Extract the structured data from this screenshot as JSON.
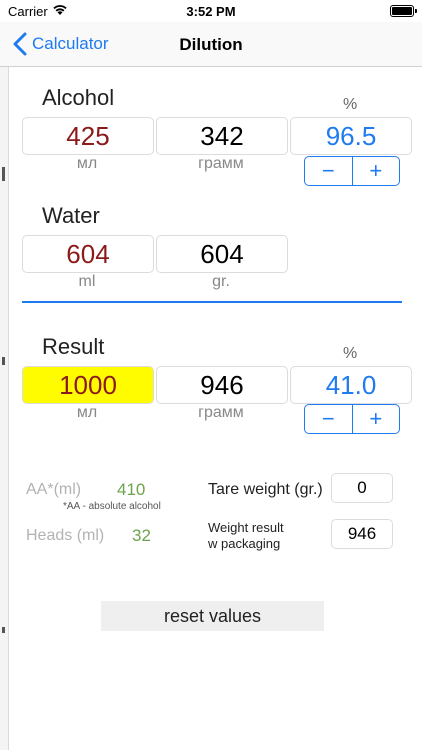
{
  "status": {
    "carrier": "Carrier",
    "time": "3:52 PM"
  },
  "nav": {
    "back_label": "Calculator",
    "title": "Dilution"
  },
  "alcohol": {
    "title": "Alcohol",
    "volume": "425",
    "volume_unit": "мл",
    "weight": "342",
    "weight_unit": "грамм",
    "percent_label": "%",
    "percent": "96.5"
  },
  "water": {
    "title": "Water",
    "volume": "604",
    "volume_unit": "ml",
    "weight": "604",
    "weight_unit": "gr."
  },
  "result": {
    "title": "Result",
    "volume": "1000",
    "volume_unit": "мл",
    "weight": "946",
    "weight_unit": "грамм",
    "percent_label": "%",
    "percent": "41.0"
  },
  "stepper": {
    "minus": "−",
    "plus": "+"
  },
  "info": {
    "aa_label": "AA*(ml)",
    "aa_value": "410",
    "aa_note": "*AA - absolute alcohol",
    "heads_label": "Heads (ml)",
    "heads_value": "32",
    "tare_label": "Tare weight (gr.)",
    "tare_value": "0",
    "weight_result_label_1": "Weight result",
    "weight_result_label_2": "w packaging",
    "weight_result_value": "946"
  },
  "reset_label": "reset values",
  "colors": {
    "accent": "#1e7bf0",
    "highlight": "#fffc00",
    "volume_text": "#8b1a1a",
    "info_value": "#6ca44b"
  }
}
